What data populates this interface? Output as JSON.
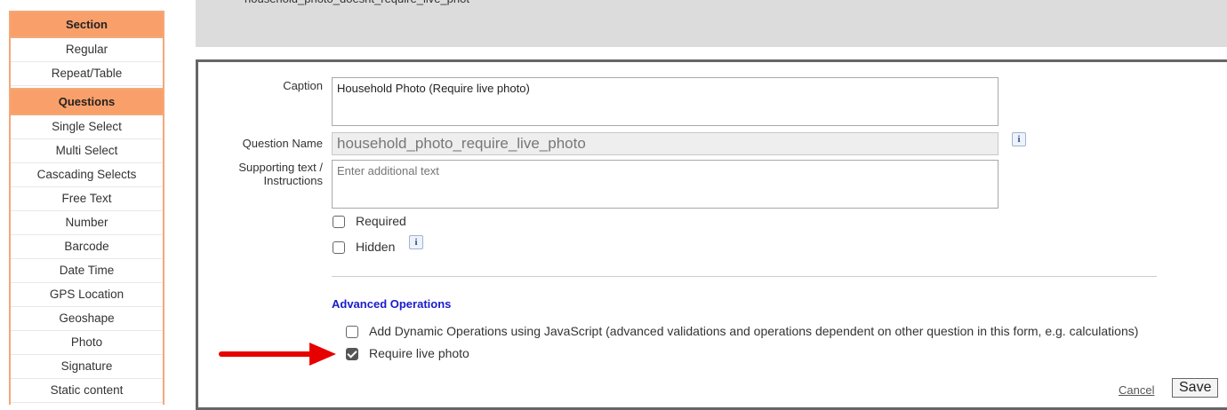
{
  "top_hint": "household_photo_doesnt_require_live_phot",
  "palette": {
    "section_header": "Section",
    "section_items": [
      "Regular",
      "Repeat/Table"
    ],
    "questions_header": "Questions",
    "question_items": [
      "Single Select",
      "Multi Select",
      "Cascading Selects",
      "Free Text",
      "Number",
      "Barcode",
      "Date Time",
      "GPS Location",
      "Geoshape",
      "Photo",
      "Signature",
      "Static content"
    ]
  },
  "editor": {
    "caption_label": "Caption",
    "caption_value": "Household Photo (Require live photo)",
    "question_name_label": "Question Name",
    "question_name_value": "household_photo_require_live_photo",
    "supporting_label_1": "Supporting text /",
    "supporting_label_2": "Instructions",
    "supporting_placeholder": "Enter additional text",
    "required_label": "Required",
    "hidden_label": "Hidden",
    "info_glyph": "i",
    "advanced_title": "Advanced Operations",
    "dynamic_ops_label": "Add Dynamic Operations using JavaScript (advanced validations and operations dependent on other question in this form, e.g. calculations)",
    "live_photo_label": "Require live photo",
    "live_photo_checked": true,
    "cancel_label": "Cancel",
    "save_label": "Save"
  },
  "colors": {
    "palette_header": "#f9a06a",
    "palette_border": "#f5a878",
    "advanced_title": "#1a1acc",
    "arrow": "#e60000"
  }
}
